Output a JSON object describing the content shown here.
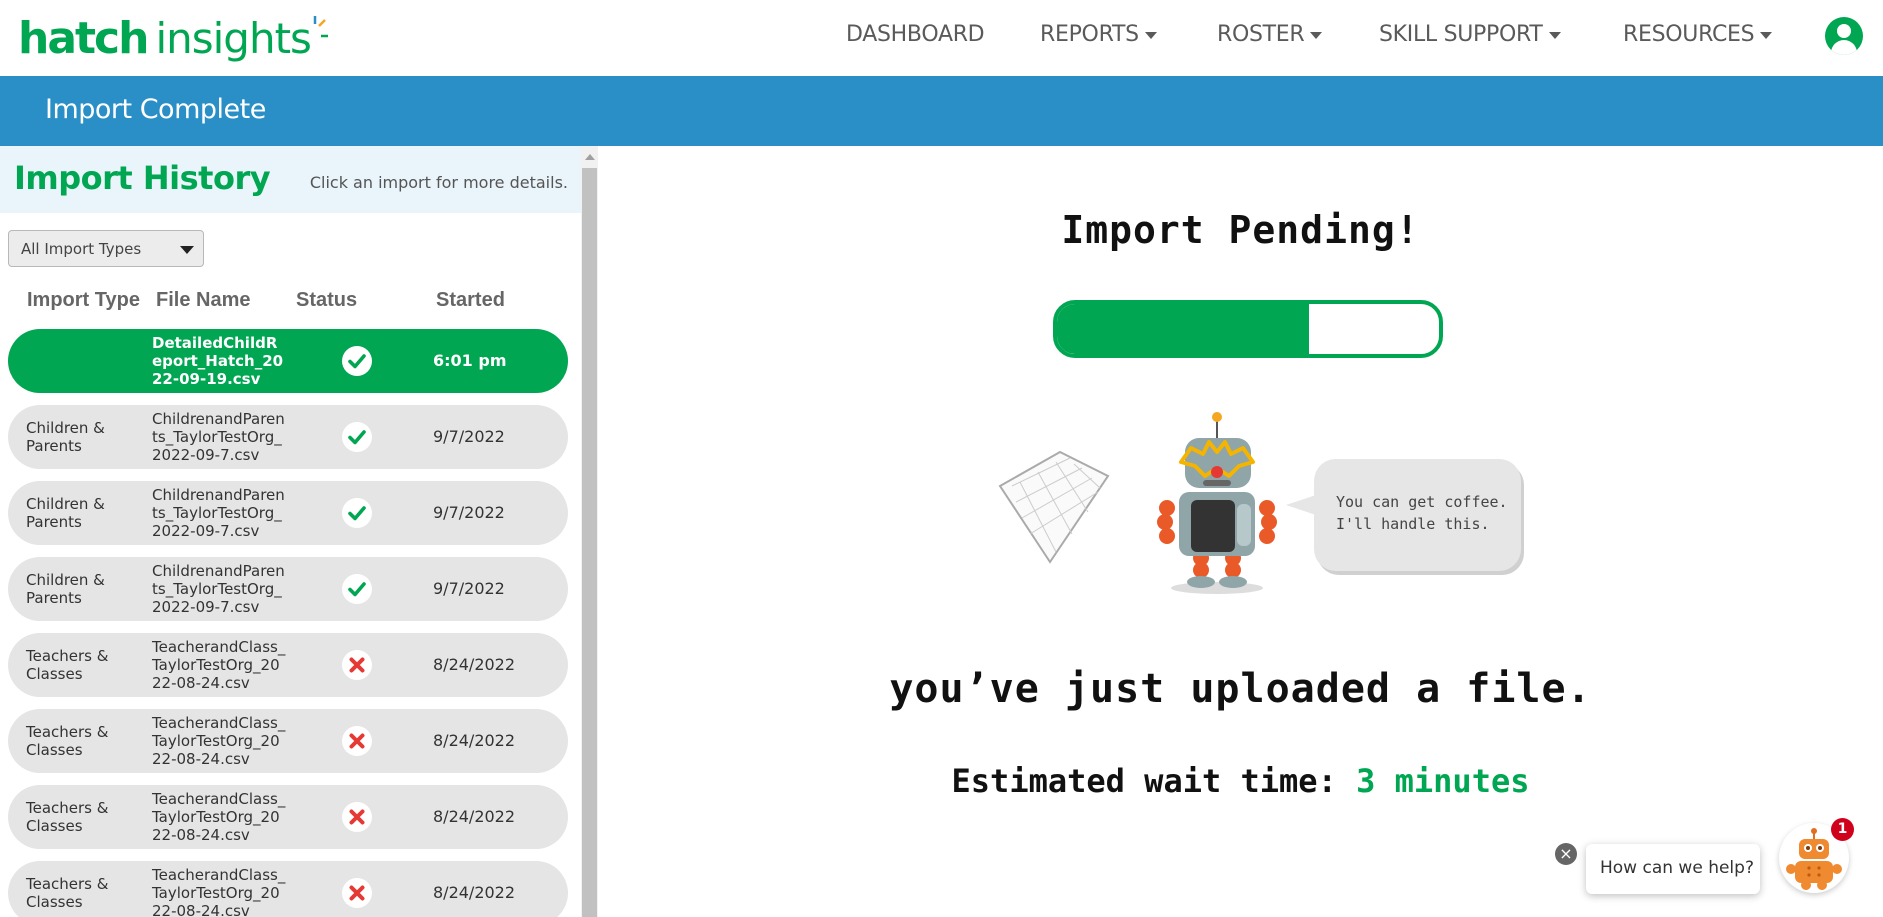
{
  "logo": {
    "part1": "hatch",
    "part2": "insights"
  },
  "nav": {
    "dashboard": "DASHBOARD",
    "reports": "REPORTS",
    "roster": "ROSTER",
    "skill_support": "SKILL SUPPORT",
    "resources": "RESOURCES"
  },
  "page": {
    "title": "Import Complete"
  },
  "history": {
    "title": "Import History",
    "hint": "Click an import for more details.",
    "filter_value": "All Import Types",
    "columns": {
      "type": "Import Type",
      "file": "File Name",
      "status": "Status",
      "started": "Started"
    },
    "rows": [
      {
        "type": "",
        "file": "DetailedChildReport_Hatch_2022-09-19.csv",
        "status": "success",
        "started": "6:01 pm"
      },
      {
        "type": "Children & Parents",
        "file": "ChildrenandParents_TaylorTestOrg_2022-09-7.csv",
        "status": "success",
        "started": "9/7/2022"
      },
      {
        "type": "Children & Parents",
        "file": "ChildrenandParents_TaylorTestOrg_2022-09-7.csv",
        "status": "success",
        "started": "9/7/2022"
      },
      {
        "type": "Children & Parents",
        "file": "ChildrenandParents_TaylorTestOrg_2022-09-7.csv",
        "status": "success",
        "started": "9/7/2022"
      },
      {
        "type": "Teachers & Classes",
        "file": "TeacherandClass_TaylorTestOrg_2022-08-24.csv",
        "status": "failed",
        "started": "8/24/2022"
      },
      {
        "type": "Teachers & Classes",
        "file": "TeacherandClass_TaylorTestOrg_2022-08-24.csv",
        "status": "failed",
        "started": "8/24/2022"
      },
      {
        "type": "Teachers & Classes",
        "file": "TeacherandClass_TaylorTestOrg_2022-08-24.csv",
        "status": "failed",
        "started": "8/24/2022"
      },
      {
        "type": "Teachers & Classes",
        "file": "TeacherandClass_TaylorTestOrg_2022-08-24.csv",
        "status": "failed",
        "started": "8/24/2022"
      }
    ]
  },
  "main": {
    "title": "Import Pending!",
    "progress": 0.66,
    "bubble_line1": "You can get coffee.",
    "bubble_line2": "I'll handle this.",
    "uploaded": "you’ve just uploaded a file.",
    "wait_label": "Estimated wait time:",
    "wait_value": "3 minutes"
  },
  "chat": {
    "prompt": "How can we help?",
    "badge": "1",
    "close": "×"
  },
  "colors": {
    "brand_green": "#00a651",
    "header_blue": "#2a8fc6",
    "error_red": "#e53935"
  }
}
